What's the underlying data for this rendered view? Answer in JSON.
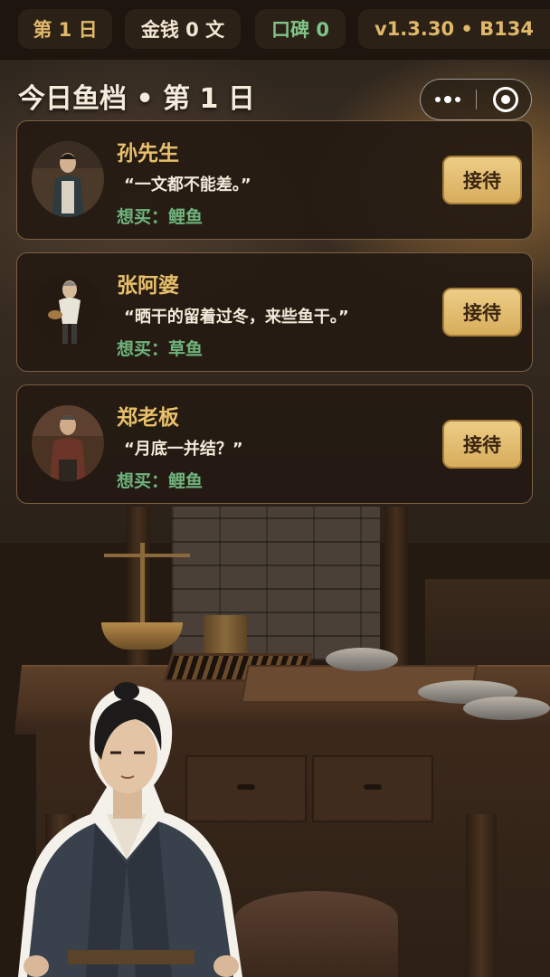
{
  "status": {
    "day_label": "第 1 日",
    "money_label": "金钱 0 文",
    "reputation_label": "口碑 0",
    "version_label": "v1.3.30 • B134"
  },
  "header": {
    "title": "今日鱼档 • 第 1 日"
  },
  "customers": [
    {
      "name": "孙先生",
      "quote": "“一文都不能差。”",
      "wants": "想买：鲤鱼",
      "serve_label": "接待"
    },
    {
      "name": "张阿婆",
      "quote": "“晒干的留着过冬，来些鱼干。”",
      "wants": "想买：草鱼",
      "serve_label": "接待"
    },
    {
      "name": "郑老板",
      "quote": "“月底一并结？”",
      "wants": "想买：鲤鱼",
      "serve_label": "接待"
    }
  ],
  "colors": {
    "accent_gold": "#e8bf6a",
    "wants_green": "#6fb37c",
    "reputation_green": "#7fc489",
    "button_gold": "#e0bd72"
  },
  "icons": {
    "capsule_more": "more-dots-icon",
    "capsule_close": "record-close-icon"
  }
}
